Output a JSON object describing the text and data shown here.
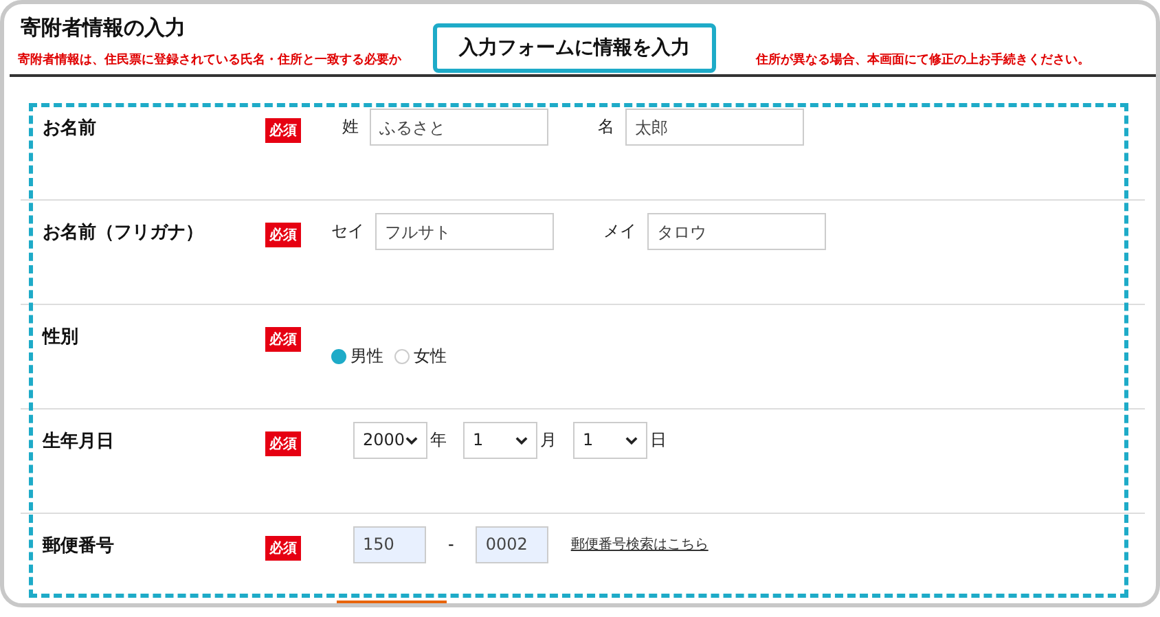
{
  "heading": "寄附者情報の入力",
  "notice": {
    "before": "寄附者情報は、住民票に登録されている氏名・住所と一致する必要か",
    "after": "住所が異なる場合、本画面にて修正の上お手続きください。"
  },
  "callout": "入力フォームに情報を入力",
  "rows": [
    {
      "kind": "pair",
      "label": "お名前",
      "required": "必須",
      "fields": [
        {
          "caption": "姓",
          "value": "ふるさと"
        },
        {
          "caption": "名",
          "value": "太郎"
        }
      ]
    },
    {
      "kind": "pair",
      "label": "お名前（フリガナ）",
      "required": "必須",
      "fields": [
        {
          "caption": "セイ",
          "value": "フルサト"
        },
        {
          "caption": "メイ",
          "value": "タロウ"
        }
      ]
    },
    {
      "kind": "radio",
      "label": "性別",
      "required": "必須",
      "options": [
        {
          "label": "男性",
          "selected": true
        },
        {
          "label": "女性",
          "selected": false
        }
      ]
    },
    {
      "kind": "date",
      "label": "生年月日",
      "required": "必須",
      "selects": [
        {
          "value": "2000",
          "unit": "年"
        },
        {
          "value": "1",
          "unit": "月"
        },
        {
          "value": "1",
          "unit": "日"
        }
      ]
    },
    {
      "kind": "postal",
      "label": "郵便番号",
      "required": "必須",
      "parts": [
        "150",
        "0002"
      ],
      "separator": "-",
      "link": "郵便番号検索はこちら"
    }
  ]
}
